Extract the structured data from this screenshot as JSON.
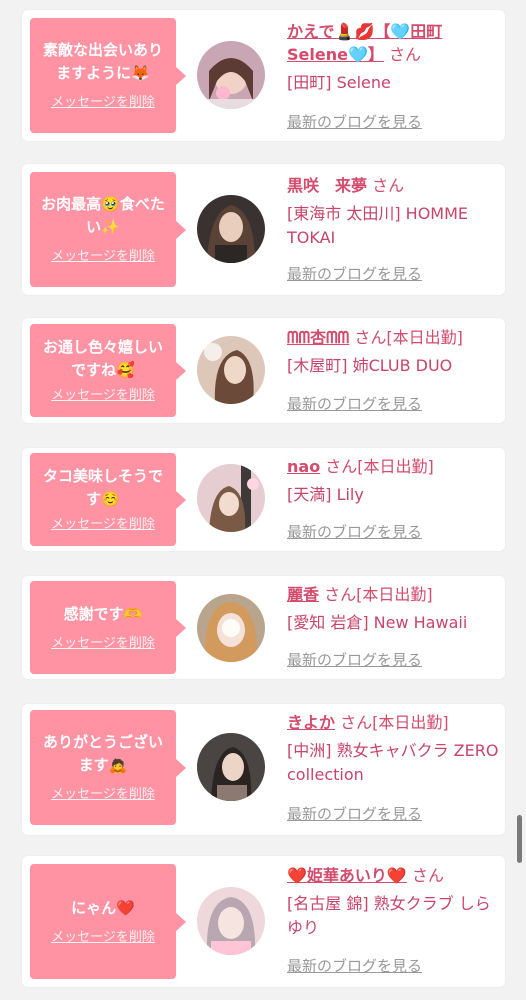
{
  "labels": {
    "delete_message": "メッセージを削除",
    "latest_blog": "最新のブログを見る",
    "honorific": "さん"
  },
  "cards": [
    {
      "message": "素敵な出会いありますように🦊",
      "name": "かえで💄💋【🩵田町Selene🩵】",
      "status": "",
      "shop": "[田町] Selene"
    },
    {
      "message": "お肉最高🥹食べたい✨",
      "name": "黒咲　来夢",
      "status": "",
      "shop": "[東海市 太田川] HOMME TOKAI"
    },
    {
      "message": "お通し色々嬉しいですね🥰",
      "name": "ᗰᗰ杏ᗰᗰ",
      "status": "[本日出勤]",
      "shop": "[木屋町] 姉CLUB DUO"
    },
    {
      "message": "タコ美味しそうです☺️",
      "name": "nao",
      "status": "[本日出勤]",
      "shop": "[天満] Lily"
    },
    {
      "message": "感謝です🫶",
      "name": "麗香",
      "status": "[本日出勤]",
      "shop": "[愛知 岩倉] New Hawaii"
    },
    {
      "message": "ありがとうございます🙇",
      "name": "きよか",
      "status": "[本日出勤]",
      "shop": "[中洲] 熟女キャバクラ ZERO collection"
    },
    {
      "message": "にゃん❤️",
      "name": "❤️姫華あいり❤️",
      "status": "",
      "shop": "[名古屋 錦] 熟女クラブ しらゆり"
    }
  ],
  "colors": {
    "accent": "#ff92a3",
    "name": "#d44b6e",
    "muted": "#999999",
    "background": "#f2f2f2"
  }
}
